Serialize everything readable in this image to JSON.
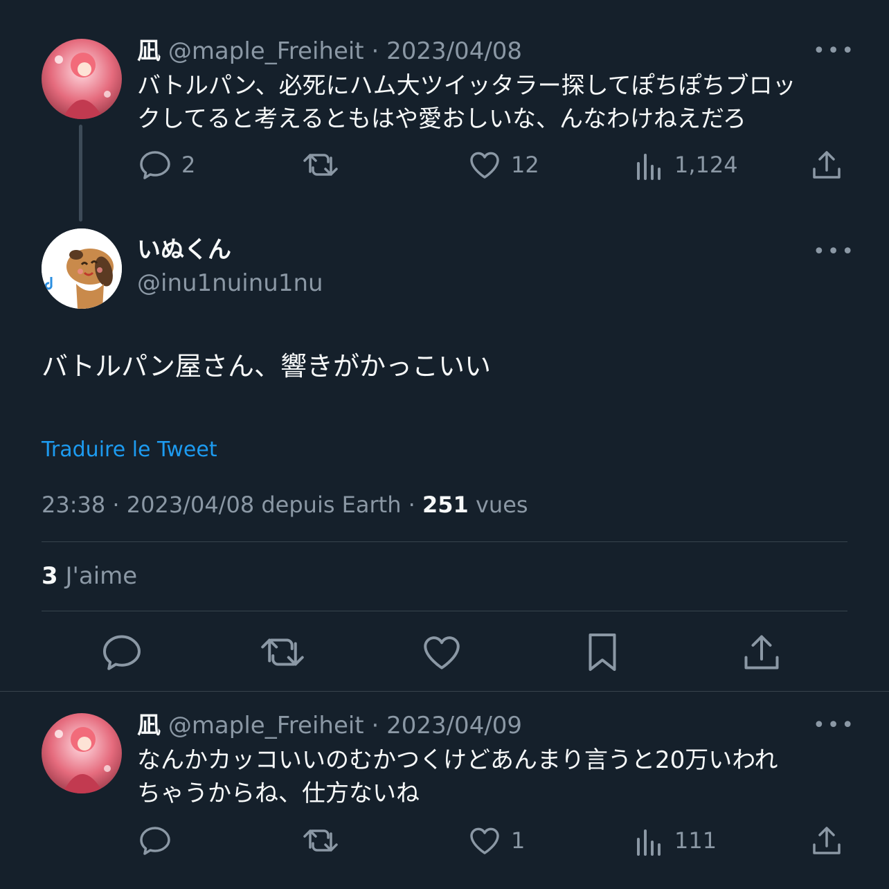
{
  "tweet1": {
    "name": "凪",
    "handle": "@maple_Freiheit",
    "sep": "·",
    "date": "2023/04/08",
    "text_line1": "バトルパン、必死にハム大ツイッタラー探してぽちぽちブロッ",
    "text_line2": "クしてると考えるともはや愛おしいな、んなわけねえだろ",
    "replies": "2",
    "likes": "12",
    "views": "1,124",
    "more": "•••"
  },
  "main": {
    "name": "いぬくん",
    "handle": "@inu1nuinu1nu",
    "text": "バトルパン屋さん、響きがかっこいい",
    "translate": "Traduire le Tweet",
    "meta_time": "23:38",
    "meta_sep": "·",
    "meta_date_source": "2023/04/08 depuis Earth",
    "meta_views_count": "251",
    "meta_views_label": "vues",
    "likes_count": "3",
    "likes_label": "J'aime",
    "more": "•••"
  },
  "tweet2": {
    "name": "凪",
    "handle": "@maple_Freiheit",
    "sep": "·",
    "date": "2023/04/09",
    "text_line1": "なんかカッコいいのむかつくけどあんまり言うと20万いわれ",
    "text_line2": "ちゃうからね、仕方ないね",
    "likes": "1",
    "views": "111",
    "more": "•••"
  },
  "colors": {
    "background": "#15202b",
    "text": "#f7f9f9",
    "muted": "#8b98a5",
    "link": "#1d9bf0",
    "divider": "#38444d"
  }
}
